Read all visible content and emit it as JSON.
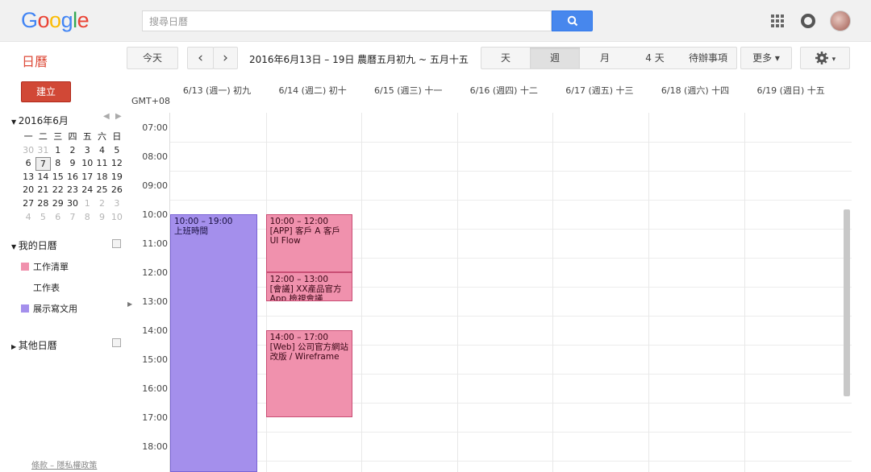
{
  "header": {
    "logo_letters": [
      "G",
      "o",
      "o",
      "g",
      "l",
      "e"
    ],
    "search_placeholder": "搜尋日曆"
  },
  "toolbar": {
    "app_title": "日曆",
    "today_label": "今天",
    "prev_label": "‹",
    "next_label": "›",
    "date_range": "2016年6月13日 – 19日 農曆五月初九 ~ 五月十五",
    "views": [
      "天",
      "週",
      "月",
      "4 天",
      "待辦事項"
    ],
    "active_view": "週",
    "more_label": "更多 ▾",
    "settings_label": "▾"
  },
  "sidebar": {
    "create_label": "建立",
    "mini_calendar": {
      "title": "2016年6月",
      "weekdays": [
        "一",
        "二",
        "三",
        "四",
        "五",
        "六",
        "日"
      ],
      "weeks": [
        [
          "30",
          "31",
          "1",
          "2",
          "3",
          "4",
          "5"
        ],
        [
          "6",
          "7",
          "8",
          "9",
          "10",
          "11",
          "12"
        ],
        [
          "13",
          "14",
          "15",
          "16",
          "17",
          "18",
          "19"
        ],
        [
          "20",
          "21",
          "22",
          "23",
          "24",
          "25",
          "26"
        ],
        [
          "27",
          "28",
          "29",
          "30",
          "1",
          "2",
          "3"
        ],
        [
          "4",
          "5",
          "6",
          "7",
          "8",
          "9",
          "10"
        ]
      ],
      "today": "7"
    },
    "my_calendars_label": "我的日曆",
    "my_calendars": [
      {
        "name": "工作清單",
        "color": "#f091ad"
      },
      {
        "name": "工作表",
        "color": ""
      },
      {
        "name": "展示寫文用",
        "color": "#a48fec"
      }
    ],
    "other_calendars_label": "其他日曆",
    "footer": "條款 – 隱私權政策"
  },
  "calendar": {
    "timezone": "GMT+08",
    "days": [
      "6/13 (週一) 初九",
      "6/14 (週二) 初十",
      "6/15 (週三) 十一",
      "6/16 (週四) 十二",
      "6/17 (週五) 十三",
      "6/18 (週六) 十四",
      "6/19 (週日) 十五"
    ],
    "hours": [
      "07:00",
      "08:00",
      "09:00",
      "10:00",
      "11:00",
      "12:00",
      "13:00",
      "14:00",
      "15:00",
      "16:00",
      "17:00",
      "18:00"
    ],
    "events": [
      {
        "day": 0,
        "start": 10,
        "end": 19,
        "time": "10:00 – 19:00",
        "title": "上班時間",
        "color": "purple"
      },
      {
        "day": 1,
        "start": 10,
        "end": 12,
        "time": "10:00 – 12:00",
        "title": "[APP] 客戶 A 客戶 UI Flow",
        "color": "pink"
      },
      {
        "day": 1,
        "start": 12,
        "end": 13,
        "time": "12:00 – 13:00",
        "title": "[會議] XX產品官方 App 檢視會議",
        "color": "pink"
      },
      {
        "day": 1,
        "start": 14,
        "end": 17,
        "time": "14:00 – 17:00",
        "title": "[Web] 公司官方網站改版 / Wireframe",
        "color": "pink"
      }
    ]
  }
}
